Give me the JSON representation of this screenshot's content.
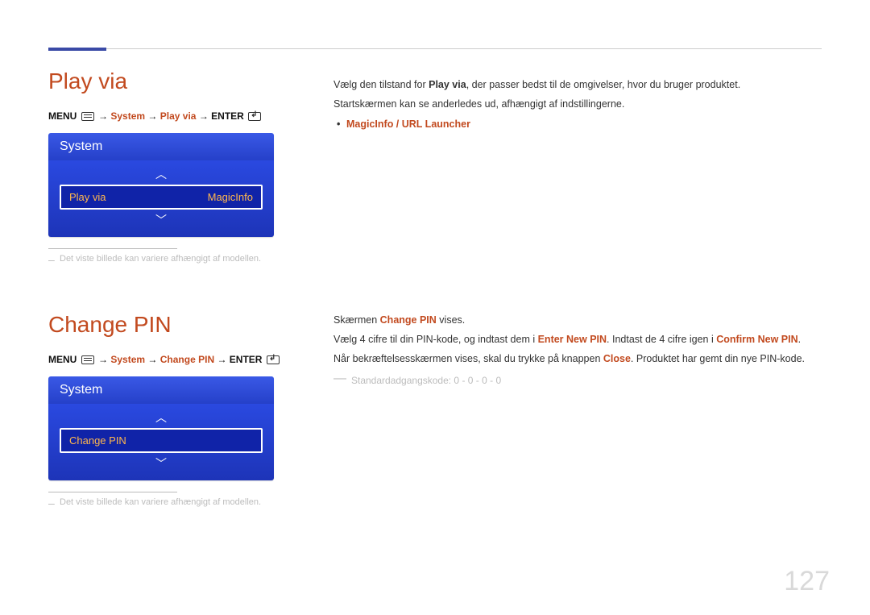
{
  "page_number": "127",
  "section1": {
    "title": "Play via",
    "breadcrumb": {
      "menu": "MENU",
      "arrow": "→",
      "p1": "System",
      "p2": "Play via",
      "enter": "ENTER"
    },
    "osd": {
      "header": "System",
      "row_label": "Play via",
      "row_value": "MagicInfo"
    },
    "note": "Det viste billede kan variere afhængigt af modellen.",
    "right": {
      "p1_pre": "Vælg den tilstand for ",
      "p1_b": "Play via",
      "p1_post": ", der passer bedst til de omgivelser, hvor du bruger produktet.",
      "p2": "Startskærmen kan se anderledes ud, afhængigt af indstillingerne.",
      "bullet": "MagicInfo / URL Launcher"
    }
  },
  "section2": {
    "title": "Change PIN",
    "breadcrumb": {
      "menu": "MENU",
      "arrow": "→",
      "p1": "System",
      "p2": "Change PIN",
      "enter": "ENTER"
    },
    "osd": {
      "header": "System",
      "row_label": "Change PIN"
    },
    "note": "Det viste billede kan variere afhængigt af modellen.",
    "right": {
      "l1_pre": "Skærmen ",
      "l1_hl": "Change PIN",
      "l1_post": " vises.",
      "l2_pre": "Vælg 4 cifre til din PIN-kode, og indtast dem i ",
      "l2_hl1": "Enter New PIN",
      "l2_mid": ". Indtast de 4 cifre igen i ",
      "l2_hl2": "Confirm New PIN",
      "l2_post": ".",
      "l3_pre": "Når bekræftelsesskærmen vises, skal du trykke på knappen ",
      "l3_hl": "Close",
      "l3_post": ". Produktet har gemt din nye PIN-kode.",
      "default_pin": "Standardadgangskode: 0 - 0 - 0 - 0"
    }
  }
}
